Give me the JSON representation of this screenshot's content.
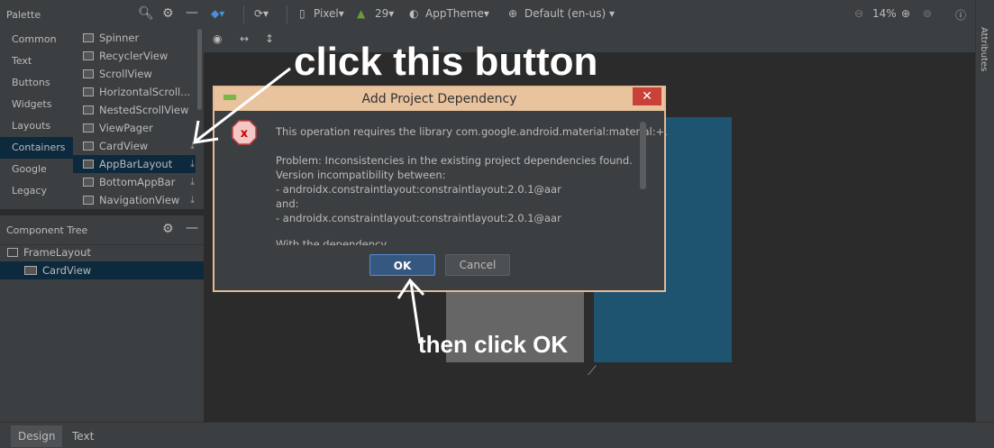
{
  "palette": {
    "title": "Palette",
    "categories": [
      "Common",
      "Text",
      "Buttons",
      "Widgets",
      "Layouts",
      "Containers",
      "Google",
      "Legacy"
    ],
    "selected_category": "Containers",
    "items": [
      {
        "label": "Spinner",
        "download": false
      },
      {
        "label": "RecyclerView",
        "download": false
      },
      {
        "label": "ScrollView",
        "download": false
      },
      {
        "label": "HorizontalScroll...",
        "download": false
      },
      {
        "label": "NestedScrollView",
        "download": false
      },
      {
        "label": "ViewPager",
        "download": false
      },
      {
        "label": "CardView",
        "download": true
      },
      {
        "label": "AppBarLayout",
        "download": true
      },
      {
        "label": "BottomAppBar",
        "download": true
      },
      {
        "label": "NavigationView",
        "download": true
      }
    ],
    "selected_item": "AppBarLayout"
  },
  "toolbar": {
    "device": "Pixel",
    "api": "29",
    "theme": "AppTheme",
    "locale": "Default (en-us)",
    "zoom": "14%"
  },
  "tree": {
    "title": "Component Tree",
    "nodes": [
      "FrameLayout",
      "CardView"
    ]
  },
  "attributes_label": "Attributes",
  "bottom_tabs": [
    "Design",
    "Text"
  ],
  "dialog": {
    "title": "Add Project Dependency",
    "close": "✕",
    "lines": [
      "This operation requires the library com.google.android.material:material:+.",
      "",
      "Problem: Inconsistencies in the existing project dependencies found.",
      "Version incompatibility between:",
      "-   androidx.constraintlayout:constraintlayout:2.0.1@aar",
      "and:",
      "-   androidx.constraintlayout:constraintlayout:2.0.1@aar",
      "",
      "With the dependency"
    ],
    "ok_label": "OK",
    "cancel_label": "Cancel"
  },
  "annotations": {
    "top": "click this button",
    "bottom": "then click OK"
  },
  "colors": {
    "accent": "#365880",
    "selection": "#0d293e",
    "dialog_border": "#e2b995",
    "teal": "#1f5470"
  }
}
